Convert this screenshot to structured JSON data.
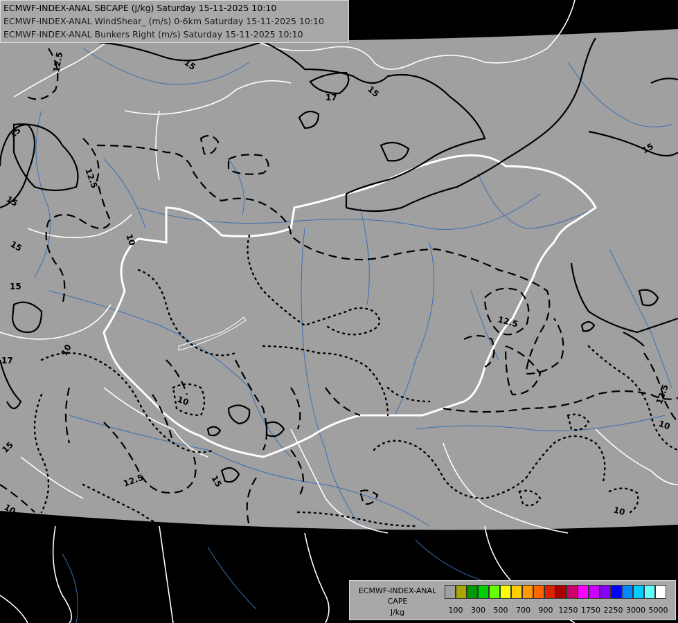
{
  "header": {
    "line1": "ECMWF-INDEX-ANAL SBCAPE (J/kg) Saturday 15-11-2025 10:10",
    "line2": "ECMWF-INDEX-ANAL WindShear_ (m/s) 0-6km Saturday 15-11-2025 10:10",
    "line3": "ECMWF-INDEX-ANAL Bunkers Right (m/s) Saturday 15-11-2025 10:10",
    "line1_color": "#000000",
    "line2_color": "#1a1a1a",
    "line3_color": "#1a1a1a"
  },
  "legend": {
    "line1": "ECMWF-INDEX-ANAL",
    "line2": "CAPE",
    "line3": "J/kg",
    "swatch_colors": [
      "#a0a0a0",
      "#a6a600",
      "#009900",
      "#00d000",
      "#66ff00",
      "#ffff00",
      "#ffcc00",
      "#ff9900",
      "#ff6600",
      "#dd2200",
      "#aa0000",
      "#cc0066",
      "#ff00ff",
      "#cc00ff",
      "#8800ff",
      "#0000ff",
      "#0088ff",
      "#00ccff",
      "#66ffff",
      "#ffffff"
    ],
    "ticks": [
      "100",
      "300",
      "500",
      "700",
      "900",
      "1250",
      "1750",
      "2250",
      "3000",
      "5000"
    ]
  },
  "map": {
    "domain_fill": "#a0a0a0",
    "outside_fill": "#000000",
    "border_color": "#ffffff",
    "river_color": "#3a6fb0",
    "contour_color": "#000000",
    "contour_labels": [
      "12.5",
      "15",
      "17",
      "15",
      "15",
      "12.5",
      "15",
      "15",
      "15",
      "10",
      "17",
      "15",
      "10",
      "12.5",
      "10",
      "15",
      "12.5",
      "10",
      "10",
      "12.5",
      "10",
      "15"
    ]
  }
}
